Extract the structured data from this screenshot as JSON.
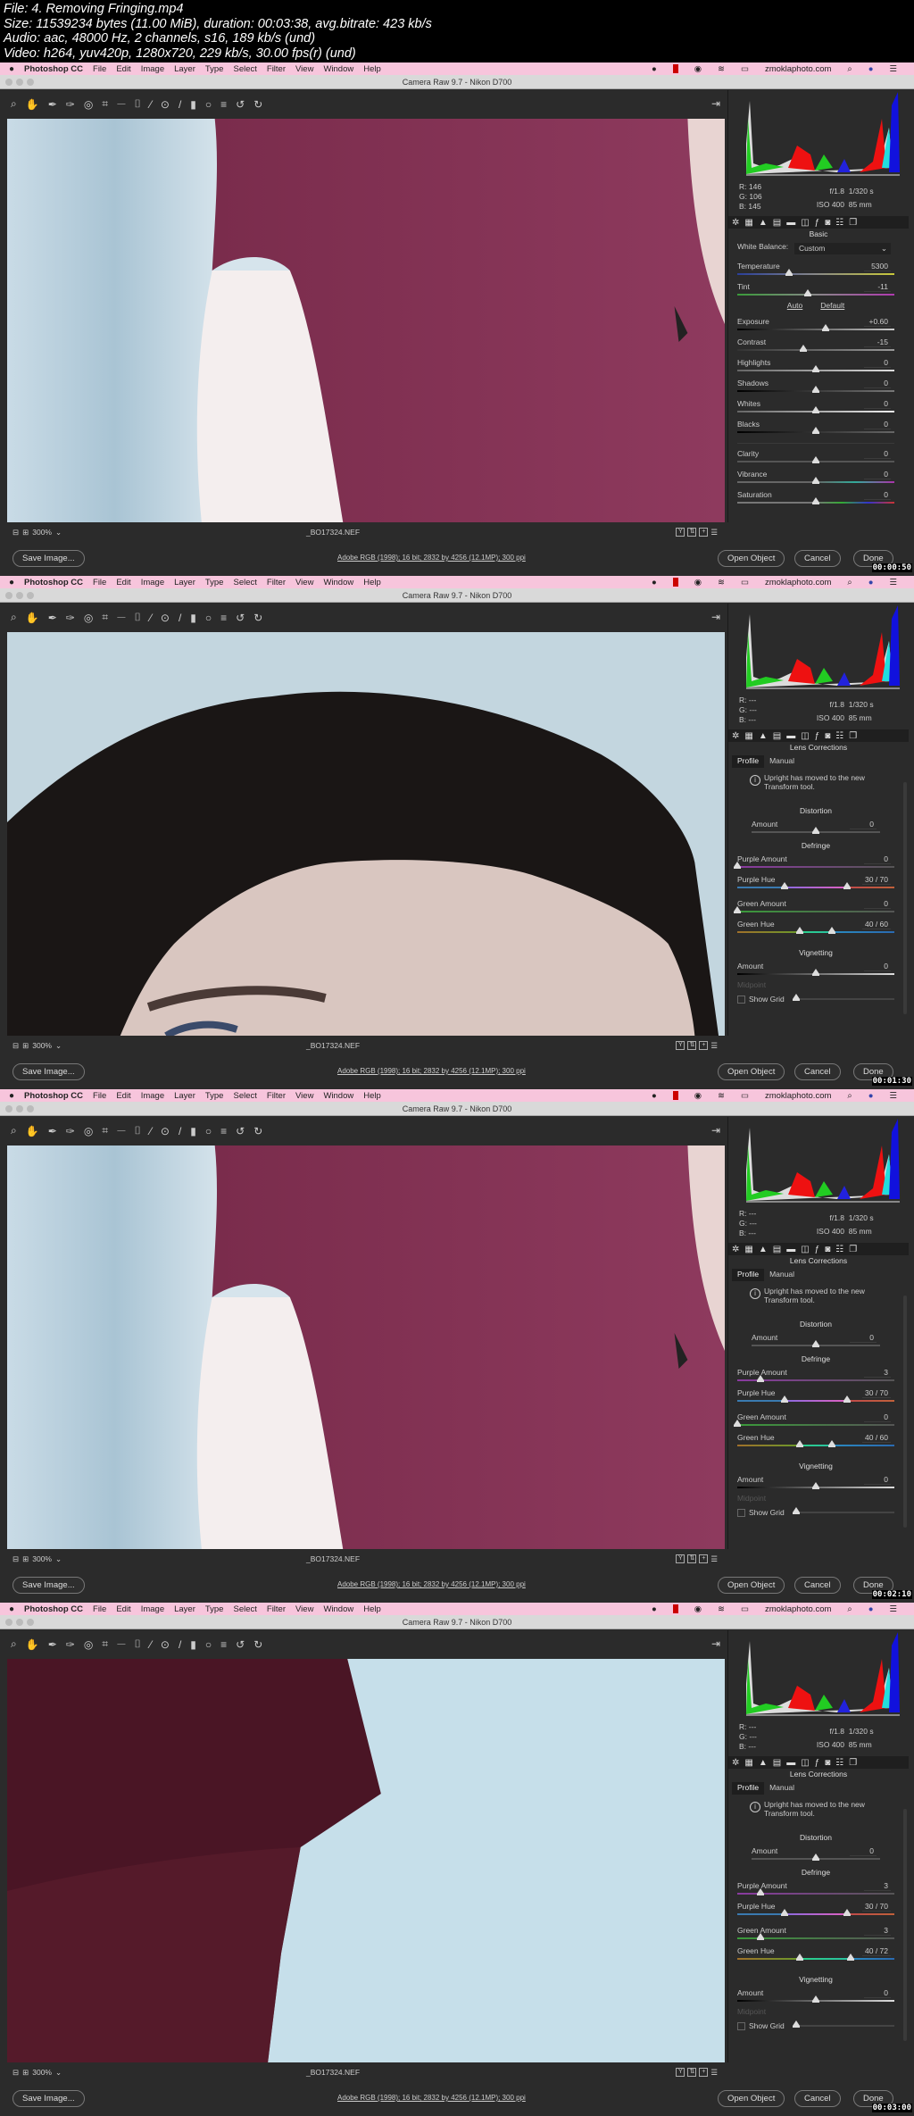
{
  "file_info": [
    "File: 4. Removing Fringing.mp4",
    "Size: 11539234 bytes (11.00 MiB), duration: 00:03:38, avg.bitrate: 423 kb/s",
    "Audio: aac, 48000 Hz, 2 channels, s16, 189 kb/s (und)",
    "Video: h264, yuv420p, 1280x720, 229 kb/s, 30.00 fps(r) (und)"
  ],
  "menubar": {
    "apple": "",
    "app": "Photoshop CC",
    "items": [
      "File",
      "Edit",
      "Image",
      "Layer",
      "Type",
      "Select",
      "Filter",
      "View",
      "Window",
      "Help"
    ],
    "site": "zmoklaphoto.com",
    "bg_color": "#f7c5dc"
  },
  "window_title": "Camera Raw 9.7  -  Nikon D700",
  "status": {
    "zoom": "300%",
    "filename": "_BO17324.NEF"
  },
  "buttons": {
    "save": "Save Image...",
    "workflow": "Adobe RGB (1998); 16 bit; 2832 by 4256 (12.1MP); 300 ppi",
    "open": "Open Object",
    "cancel": "Cancel",
    "done": "Done"
  },
  "camera": {
    "aperture": "f/1.8",
    "shutter": "1/320 s",
    "iso": "ISO 400",
    "focal": "85 mm"
  },
  "rgb_labels": {
    "r": "R:",
    "g": "G:",
    "b": "B:"
  },
  "basic": {
    "title": "Basic",
    "wb_label": "White Balance:",
    "wb_value": "Custom",
    "auto": "Auto",
    "default": "Default",
    "sliders": [
      {
        "label": "Temperature",
        "value": "5300",
        "level": 0.33
      },
      {
        "label": "Tint",
        "value": "-11",
        "level": 0.45
      },
      {
        "label": "Exposure",
        "value": "+0.60",
        "level": 0.56
      },
      {
        "label": "Contrast",
        "value": "-15",
        "level": 0.42
      },
      {
        "label": "Highlights",
        "value": "0",
        "level": 0.5
      },
      {
        "label": "Shadows",
        "value": "0",
        "level": 0.5
      },
      {
        "label": "Whites",
        "value": "0",
        "level": 0.5
      },
      {
        "label": "Blacks",
        "value": "0",
        "level": 0.5
      },
      {
        "label": "Clarity",
        "value": "0",
        "level": 0.5
      },
      {
        "label": "Vibrance",
        "value": "0",
        "level": 0.5
      },
      {
        "label": "Saturation",
        "value": "0",
        "level": 0.5
      }
    ]
  },
  "lens": {
    "title": "Lens Corrections",
    "tab_profile": "Profile",
    "tab_manual": "Manual",
    "note": "Upright has moved to the new Transform tool.",
    "distortion": "Distortion",
    "amount": "Amount",
    "defringe": "Defringe",
    "purple_amount": "Purple Amount",
    "purple_hue": "Purple Hue",
    "green_amount": "Green Amount",
    "green_hue": "Green Hue",
    "vignetting": "Vignetting",
    "midpoint": "Midpoint",
    "show_grid": "Show Grid"
  },
  "frames": [
    {
      "timestamp": "00:00:50",
      "panel": "basic",
      "rgb": {
        "r": "146",
        "g": "106",
        "b": "145"
      },
      "scene": "shirt-arm"
    },
    {
      "timestamp": "00:01:30",
      "panel": "lens",
      "rgb": {
        "r": "---",
        "g": "---",
        "b": "---"
      },
      "scene": "hair",
      "distortion_amount": "0",
      "purple_amount": "0",
      "purple_amount_level": 0,
      "purple_hue": "30 / 70",
      "purple_hue_levels": [
        0.3,
        0.7
      ],
      "green_amount": "0",
      "green_amount_level": 0,
      "green_hue": "40 / 60",
      "green_hue_levels": [
        0.4,
        0.6
      ],
      "vignette_amount": "0"
    },
    {
      "timestamp": "00:02:10",
      "panel": "lens",
      "rgb": {
        "r": "---",
        "g": "---",
        "b": "---"
      },
      "scene": "shirt-arm",
      "distortion_amount": "0",
      "purple_amount": "3",
      "purple_amount_level": 0.15,
      "purple_hue": "30 / 70",
      "purple_hue_levels": [
        0.3,
        0.7
      ],
      "green_amount": "0",
      "green_amount_level": 0,
      "green_hue": "40 / 60",
      "green_hue_levels": [
        0.4,
        0.6
      ],
      "vignette_amount": "0"
    },
    {
      "timestamp": "00:03:00",
      "panel": "lens",
      "rgb": {
        "r": "---",
        "g": "---",
        "b": "---"
      },
      "scene": "shirt-sky",
      "distortion_amount": "0",
      "purple_amount": "3",
      "purple_amount_level": 0.15,
      "purple_hue": "30 / 70",
      "purple_hue_levels": [
        0.3,
        0.7
      ],
      "green_amount": "3",
      "green_amount_level": 0.15,
      "green_hue": "40 / 72",
      "green_hue_levels": [
        0.4,
        0.72
      ],
      "vignette_amount": "0"
    }
  ]
}
